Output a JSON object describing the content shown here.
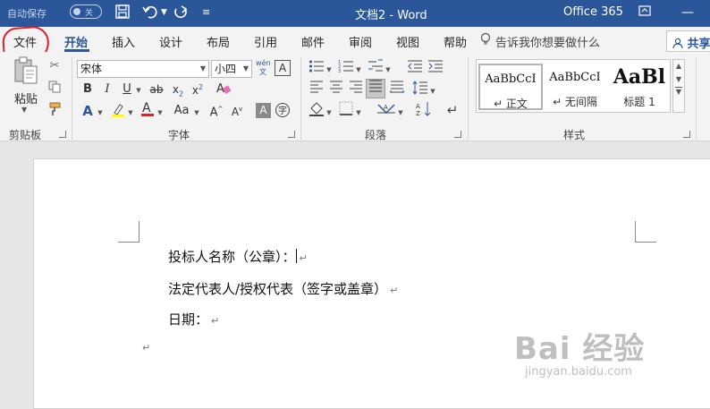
{
  "titlebar": {
    "autosave_label": "自动保存",
    "autosave_state": "关",
    "doc_title": "文档2  -  Word",
    "office365": "Office 365"
  },
  "tabs": [
    "文件",
    "开始",
    "插入",
    "设计",
    "布局",
    "引用",
    "邮件",
    "审阅",
    "视图",
    "帮助"
  ],
  "active_tab": "开始",
  "tell_me": "告诉我你想要做什么",
  "share_label": "共享",
  "ribbon": {
    "clipboard": {
      "paste": "粘贴",
      "group_label": "剪贴板"
    },
    "font": {
      "font_name": "宋体",
      "font_size": "小四",
      "group_label": "字体"
    },
    "paragraph": {
      "group_label": "段落"
    },
    "styles": {
      "group_label": "样式",
      "items": [
        {
          "sample": "AaBbCcI",
          "name": "↵ 正文"
        },
        {
          "sample": "AaBbCcI",
          "name": "↵ 无间隔"
        },
        {
          "sample": "AaBl",
          "name": "标题 1"
        }
      ]
    }
  },
  "document": {
    "lines": [
      "投标人名称（公章）：",
      "法定代表人/授权代表（签字或盖章）",
      "日期：",
      ""
    ]
  },
  "watermark": {
    "brand": "Bai 经验",
    "site": "jingyan.baidu.com"
  },
  "colors": {
    "accent": "#2b579a",
    "annotation": "#e0202b"
  }
}
